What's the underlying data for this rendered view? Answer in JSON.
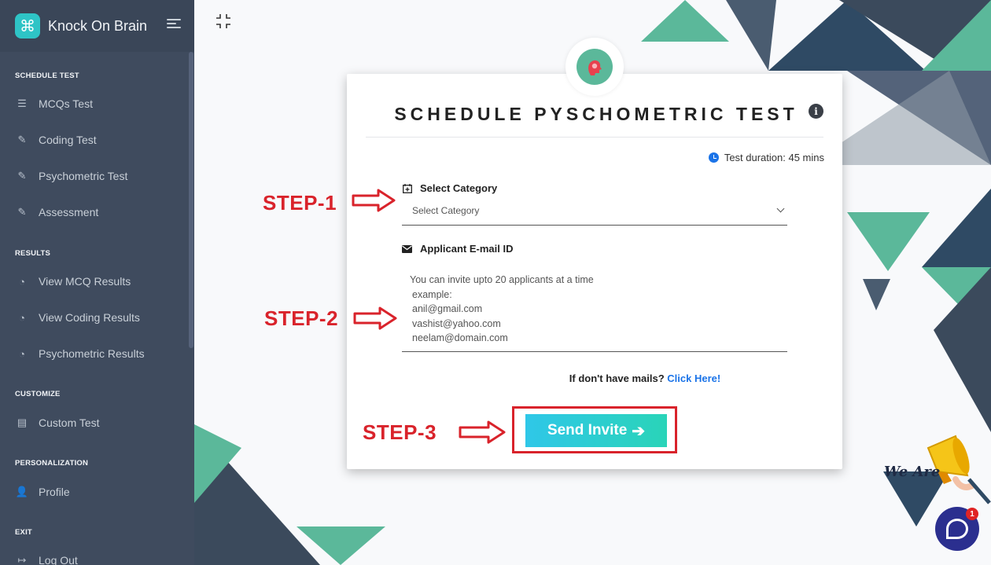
{
  "app": {
    "name": "Knock On Brain",
    "logo_glyph": "⌘"
  },
  "sidebar": {
    "sections": [
      {
        "title": "SCHEDULE TEST",
        "items": [
          {
            "label": "MCQs Test",
            "icon": "list-icon"
          },
          {
            "label": "Coding Test",
            "icon": "edit-icon"
          },
          {
            "label": "Psychometric Test",
            "icon": "edit-icon"
          },
          {
            "label": "Assessment",
            "icon": "edit-icon"
          }
        ]
      },
      {
        "title": "RESULTS",
        "items": [
          {
            "label": "View MCQ Results",
            "icon": "pie-chart-icon"
          },
          {
            "label": "View Coding Results",
            "icon": "pie-chart-icon"
          },
          {
            "label": "Psychometric Results",
            "icon": "pie-chart-icon"
          }
        ]
      },
      {
        "title": "CUSTOMIZE",
        "items": [
          {
            "label": "Custom Test",
            "icon": "file-icon"
          }
        ]
      },
      {
        "title": "PERSONALIZATION",
        "items": [
          {
            "label": "Profile",
            "icon": "user-icon"
          }
        ]
      },
      {
        "title": "EXIT",
        "items": [
          {
            "label": "Log Out",
            "icon": "logout-icon"
          }
        ]
      }
    ]
  },
  "card": {
    "title": "SCHEDULE PYSCHOMETRIC TEST",
    "info_glyph": "i",
    "duration": "Test duration: 45 mins",
    "category_label": "Select Category",
    "category_placeholder": "Select Category",
    "email_label": "Applicant E-mail ID",
    "email_placeholder_lines": [
      "You can invite upto 20 applicants at a time",
      "example:",
      "anil@gmail.com",
      "vashist@yahoo.com",
      "neelam@domain.com"
    ],
    "no_mail_text": "If don't have mails?",
    "no_mail_link": "Click Here!",
    "send_label": "Send Invite",
    "send_arrow": "➔"
  },
  "annotations": {
    "step1": "STEP-1",
    "step2": "STEP-2",
    "step3": "STEP-3",
    "color": "#d9232b"
  },
  "chat": {
    "badge": "1"
  },
  "promo": {
    "text": "We Are"
  },
  "colors": {
    "sidebar_bg": "#3f4b5e",
    "teal": "#5bb89a",
    "slate": "#3b4a5c",
    "accent_link": "#1a73e8"
  }
}
